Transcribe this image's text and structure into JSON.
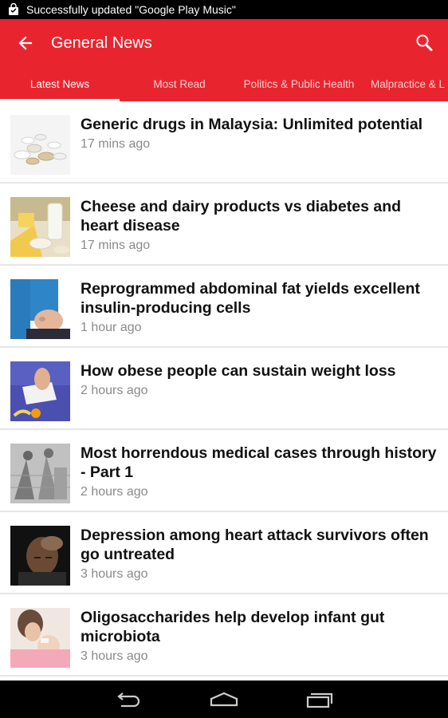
{
  "status_bar": {
    "notification_text": "Successfully updated \"Google Play Music\"",
    "notification_icon": "shopping-bag-icon"
  },
  "toolbar": {
    "title": "General News",
    "back_icon": "arrow-back-icon",
    "search_icon": "search-icon",
    "color": "#e8252f"
  },
  "tabs": [
    {
      "label": "Latest News",
      "active": true
    },
    {
      "label": "Most Read",
      "active": false
    },
    {
      "label": "Politics & Public Health",
      "active": false
    },
    {
      "label": "Malpractice & L",
      "active": false
    }
  ],
  "articles": [
    {
      "title": "Generic drugs in Malaysia: Unlimited potential",
      "time": "17 mins ago",
      "thumb": "pills"
    },
    {
      "title": "Cheese and dairy products vs diabetes and heart disease",
      "time": "17 mins ago",
      "thumb": "dairy"
    },
    {
      "title": "Reprogrammed abdominal fat yields excellent insulin-producing cells",
      "time": "1 hour ago",
      "thumb": "belly"
    },
    {
      "title": "How obese people can sustain weight loss",
      "time": "2 hours ago",
      "thumb": "scale"
    },
    {
      "title": "Most horrendous medical cases through history - Part 1",
      "time": "2 hours ago",
      "thumb": "engraving"
    },
    {
      "title": "Depression among heart attack survivors often go untreated",
      "time": "3 hours ago",
      "thumb": "man"
    },
    {
      "title": "Oligosaccharides help develop infant gut microbiota",
      "time": "3 hours ago",
      "thumb": "baby"
    }
  ],
  "nav_bar": {
    "back_icon": "nav-back-icon",
    "home_icon": "nav-home-icon",
    "recents_icon": "nav-recents-icon"
  }
}
